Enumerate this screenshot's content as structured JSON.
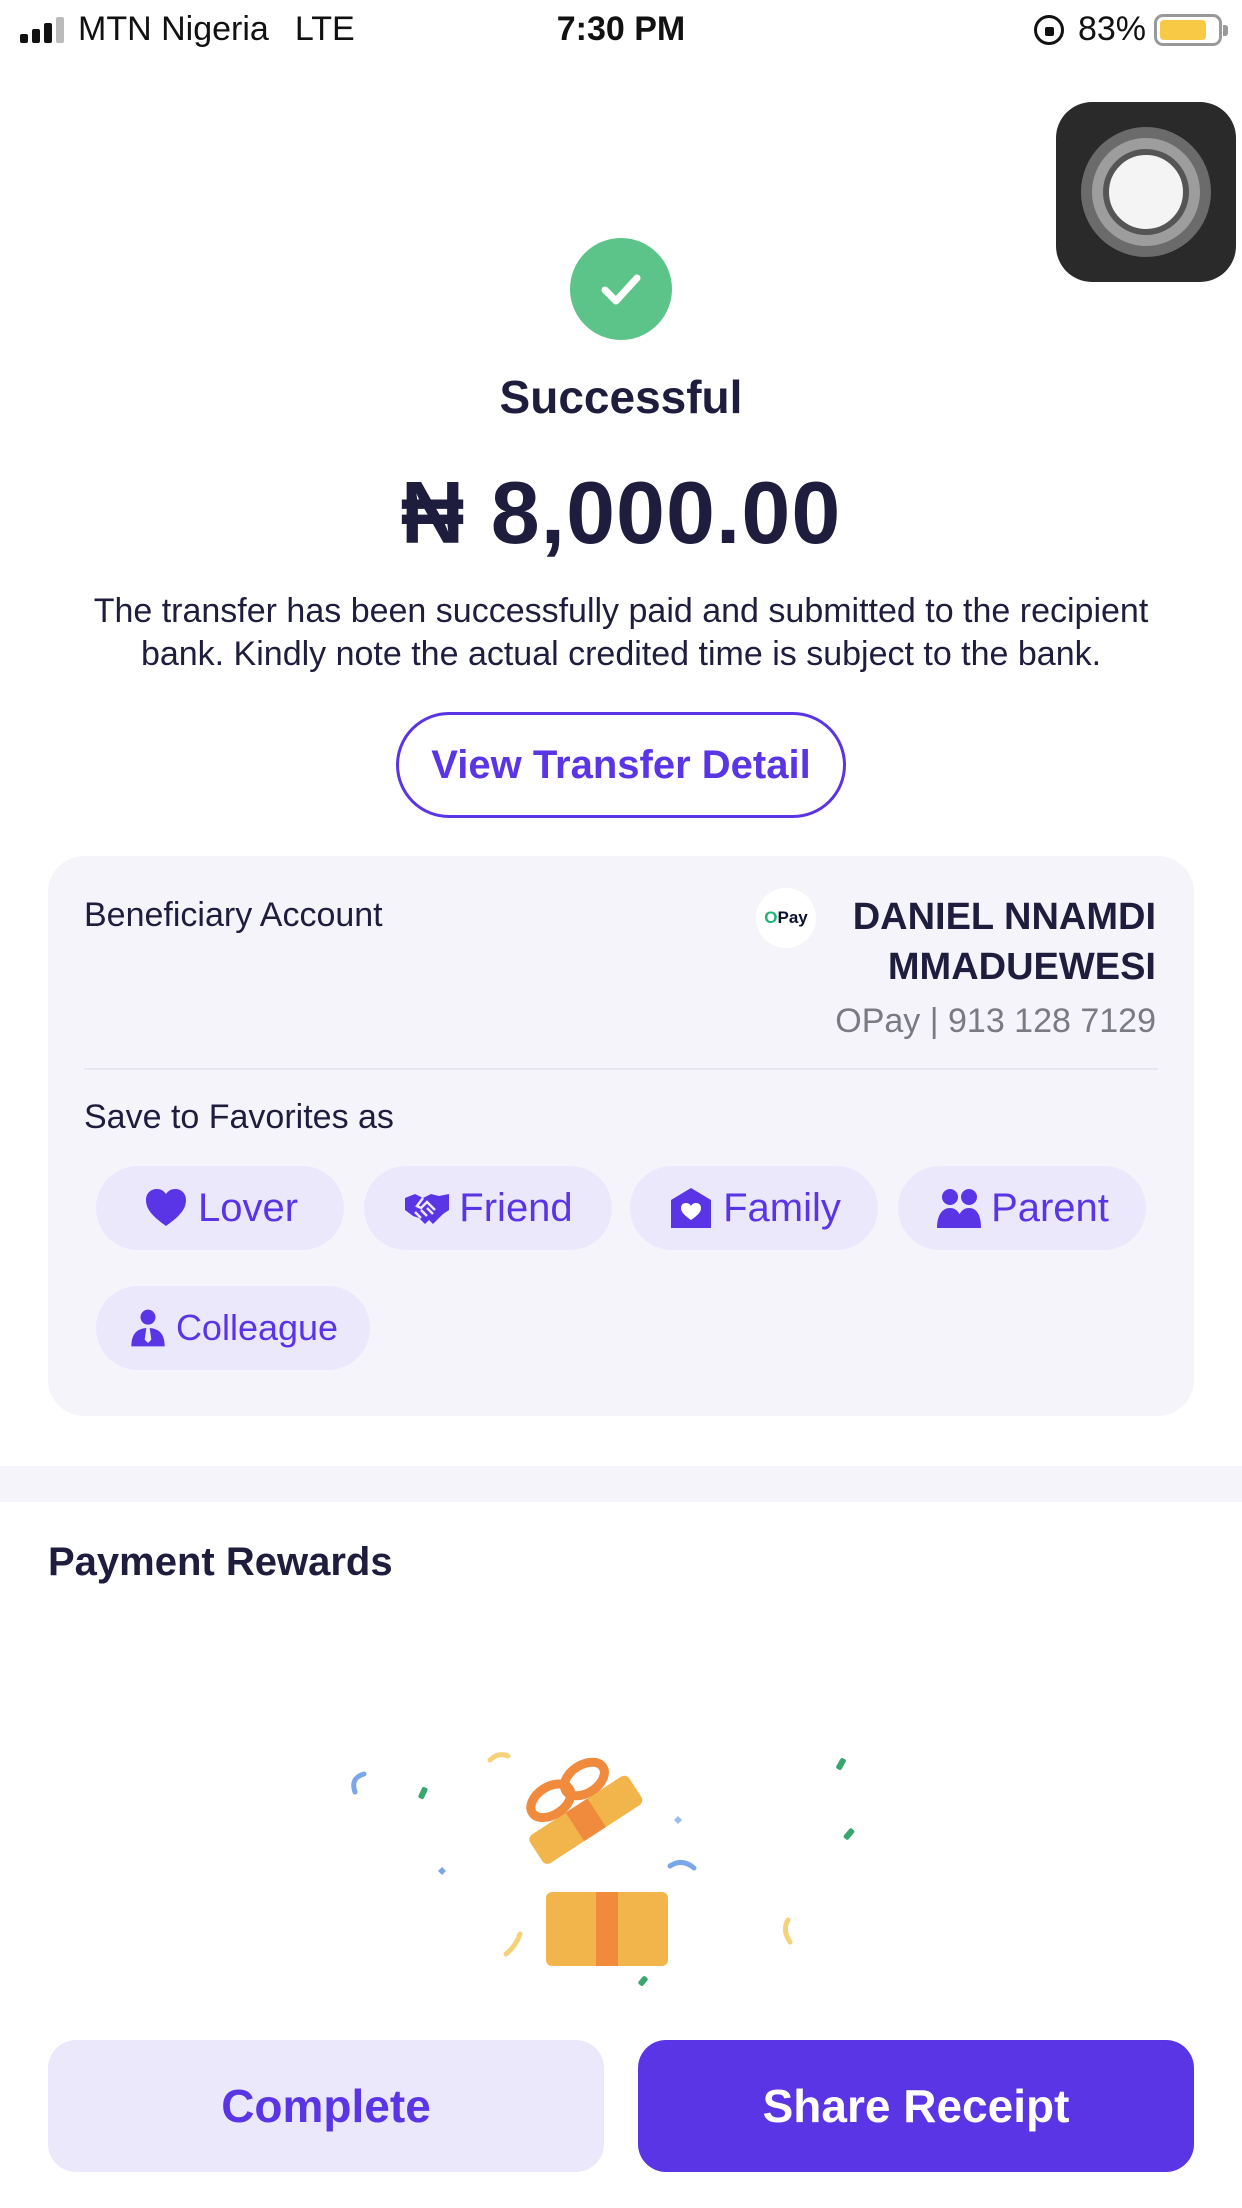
{
  "status_bar": {
    "carrier": "MTN Nigeria",
    "network": "LTE",
    "time": "7:30 PM",
    "battery": "83%",
    "battery_level": 0.83
  },
  "result": {
    "title": "Successful",
    "amount": "₦ 8,000.00",
    "description": "The transfer has been successfully paid and submitted to the recipient bank. Kindly note the actual credited time is subject to the bank.",
    "detail_button": "View Transfer Detail"
  },
  "beneficiary": {
    "label": "Beneficiary Account",
    "bank_logo_text": "Pay",
    "bank_logo_mark": "O",
    "name_line1": "DANIEL NNAMDI",
    "name_line2": "MMADUEWESI",
    "account": "OPay | 913 128 7129"
  },
  "favorites": {
    "label": "Save to Favorites as",
    "options": [
      {
        "label": "Lover",
        "icon": "heart-icon"
      },
      {
        "label": "Friend",
        "icon": "handshake-icon"
      },
      {
        "label": "Family",
        "icon": "home-heart-icon"
      },
      {
        "label": "Parent",
        "icon": "people-icon"
      },
      {
        "label": "Colleague",
        "icon": "person-tie-icon"
      }
    ]
  },
  "rewards": {
    "title": "Payment Rewards",
    "illustration": "gift-box-icon"
  },
  "actions": {
    "complete": "Complete",
    "share": "Share Receipt"
  },
  "colors": {
    "accent": "#5a35e6",
    "success": "#5cc488",
    "card_bg": "#f5f4fb",
    "chip_bg": "#ebe8fb"
  }
}
